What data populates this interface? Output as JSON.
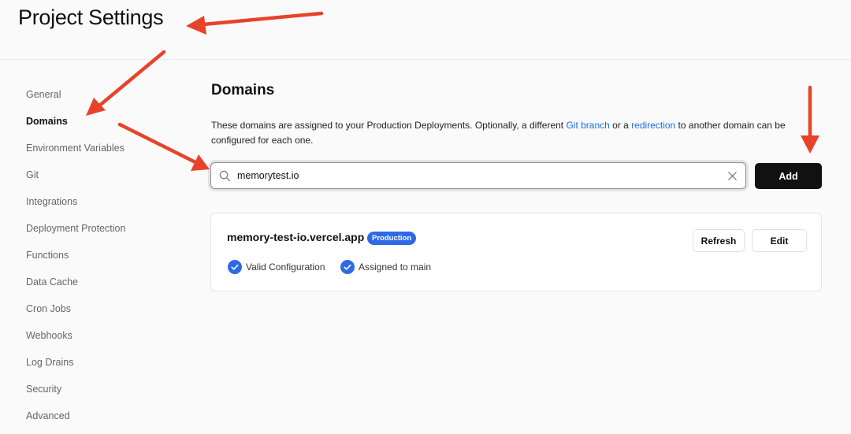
{
  "header": {
    "title": "Project Settings"
  },
  "sidebar": {
    "items": [
      {
        "label": "General"
      },
      {
        "label": "Domains",
        "active": true
      },
      {
        "label": "Environment Variables"
      },
      {
        "label": "Git"
      },
      {
        "label": "Integrations"
      },
      {
        "label": "Deployment Protection"
      },
      {
        "label": "Functions"
      },
      {
        "label": "Data Cache"
      },
      {
        "label": "Cron Jobs"
      },
      {
        "label": "Webhooks"
      },
      {
        "label": "Log Drains"
      },
      {
        "label": "Security"
      },
      {
        "label": "Advanced"
      }
    ]
  },
  "main": {
    "title": "Domains",
    "description": {
      "part1": "These domains are assigned to your Production Deployments. Optionally, a different ",
      "link1": "Git branch",
      "part2": " or a ",
      "link2": "redirection",
      "part3": " to another domain can be configured for each one."
    },
    "search": {
      "value": "memorytest.io",
      "icon": "search-icon",
      "clear_icon": "close-icon"
    },
    "add_label": "Add",
    "domain": {
      "name": "memory-test-io.vercel.app",
      "badge": "Production",
      "refresh_label": "Refresh",
      "edit_label": "Edit",
      "statuses": [
        {
          "label": "Valid Configuration",
          "icon": "check-circle-icon"
        },
        {
          "label": "Assigned to main",
          "icon": "check-circle-icon"
        }
      ]
    }
  },
  "colors": {
    "accent": "#2f6ae6",
    "link": "#1a6ee8",
    "button_dark": "#111111",
    "annotation_arrow": "#e8432a"
  }
}
